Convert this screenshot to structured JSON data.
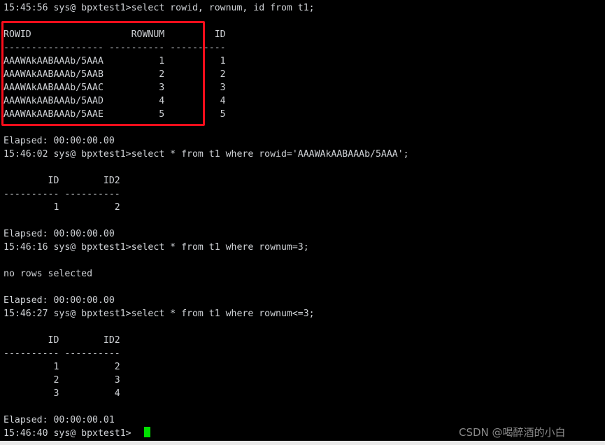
{
  "terminal": {
    "prompt_user": "sys@",
    "prompt_db": "bpxtest1>",
    "colors": {
      "background": "#000000",
      "foreground": "#cfd2d6",
      "cursor": "#00e000",
      "highlight_box": "#fc0d1b",
      "watermark": "#8b8b8b",
      "bottom_bar": "#e9e9e9"
    },
    "lines": [
      {
        "id": "l0",
        "text": "15:45:56 sys@ bpxtest1>select rowid, rownum, id from t1;"
      },
      {
        "id": "l1",
        "text": ""
      },
      {
        "id": "l2",
        "text": "ROWID                  ROWNUM         ID"
      },
      {
        "id": "l3",
        "text": "------------------ ---------- ----------"
      },
      {
        "id": "l4",
        "text": "AAAWAkAABAAAb/5AAA          1          1"
      },
      {
        "id": "l5",
        "text": "AAAWAkAABAAAb/5AAB          2          2"
      },
      {
        "id": "l6",
        "text": "AAAWAkAABAAAb/5AAC          3          3"
      },
      {
        "id": "l7",
        "text": "AAAWAkAABAAAb/5AAD          4          4"
      },
      {
        "id": "l8",
        "text": "AAAWAkAABAAAb/5AAE          5          5"
      },
      {
        "id": "l9",
        "text": ""
      },
      {
        "id": "l10",
        "text": "Elapsed: 00:00:00.00"
      },
      {
        "id": "l11",
        "text": "15:46:02 sys@ bpxtest1>select * from t1 where rowid='AAAWAkAABAAAb/5AAA';"
      },
      {
        "id": "l12",
        "text": ""
      },
      {
        "id": "l13",
        "text": "        ID        ID2"
      },
      {
        "id": "l14",
        "text": "---------- ----------"
      },
      {
        "id": "l15",
        "text": "         1          2"
      },
      {
        "id": "l16",
        "text": ""
      },
      {
        "id": "l17",
        "text": "Elapsed: 00:00:00.00"
      },
      {
        "id": "l18",
        "text": "15:46:16 sys@ bpxtest1>select * from t1 where rownum=3;"
      },
      {
        "id": "l19",
        "text": ""
      },
      {
        "id": "l20",
        "text": "no rows selected"
      },
      {
        "id": "l21",
        "text": ""
      },
      {
        "id": "l22",
        "text": "Elapsed: 00:00:00.00"
      },
      {
        "id": "l23",
        "text": "15:46:27 sys@ bpxtest1>select * from t1 where rownum<=3;"
      },
      {
        "id": "l24",
        "text": ""
      },
      {
        "id": "l25",
        "text": "        ID        ID2"
      },
      {
        "id": "l26",
        "text": "---------- ----------"
      },
      {
        "id": "l27",
        "text": "         1          2"
      },
      {
        "id": "l28",
        "text": "         2          3"
      },
      {
        "id": "l29",
        "text": "         3          4"
      },
      {
        "id": "l30",
        "text": ""
      },
      {
        "id": "l31",
        "text": "Elapsed: 00:00:00.01"
      },
      {
        "id": "l32",
        "text": "15:46:40 sys@ bpxtest1>"
      }
    ]
  },
  "result_tables": [
    {
      "name": "rowid-rownum-id-table",
      "columns": [
        "ROWID",
        "ROWNUM",
        "ID"
      ],
      "rows": [
        [
          "AAAWAkAABAAAb/5AAA",
          "1",
          "1"
        ],
        [
          "AAAWAkAABAAAb/5AAB",
          "2",
          "2"
        ],
        [
          "AAAWAkAABAAAb/5AAC",
          "3",
          "3"
        ],
        [
          "AAAWAkAABAAAb/5AAD",
          "4",
          "4"
        ],
        [
          "AAAWAkAABAAAb/5AAE",
          "5",
          "5"
        ]
      ]
    },
    {
      "name": "rowid-filter-table",
      "columns": [
        "ID",
        "ID2"
      ],
      "rows": [
        [
          "1",
          "2"
        ]
      ]
    },
    {
      "name": "rownum-le-3-table",
      "columns": [
        "ID",
        "ID2"
      ],
      "rows": [
        [
          "1",
          "2"
        ],
        [
          "2",
          "3"
        ],
        [
          "3",
          "4"
        ]
      ]
    }
  ],
  "queries": [
    {
      "time": "15:45:56",
      "sql": "select rowid, rownum, id from t1;",
      "elapsed": "00:00:00.00"
    },
    {
      "time": "15:46:02",
      "sql": "select * from t1 where rowid='AAAWAkAABAAAb/5AAA';",
      "elapsed": "00:00:00.00"
    },
    {
      "time": "15:46:16",
      "sql": "select * from t1 where rownum=3;",
      "elapsed": "00:00:00.00",
      "result": "no rows selected"
    },
    {
      "time": "15:46:27",
      "sql": "select * from t1 where rownum<=3;",
      "elapsed": "00:00:00.01"
    }
  ],
  "annotation": {
    "type": "rectangle-highlight",
    "color": "#fc0d1b"
  },
  "watermark": {
    "text": "CSDN @喝醉酒的小白"
  }
}
